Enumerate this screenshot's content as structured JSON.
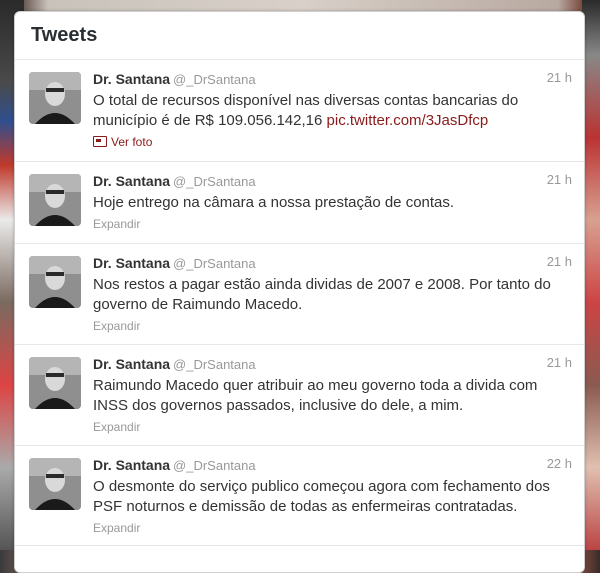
{
  "panel": {
    "title": "Tweets"
  },
  "tweets": [
    {
      "name": "Dr. Santana",
      "handle": "@_DrSantana",
      "time": "21 h",
      "text": "O total de recursos disponível nas diversas contas bancarias do município é de R$ 109.056.142,16",
      "link": "pic.twitter.com/3JasDfcp",
      "action": "Ver foto",
      "action_icon": "photo-icon"
    },
    {
      "name": "Dr. Santana",
      "handle": "@_DrSantana",
      "time": "21 h",
      "text": "Hoje entrego na câmara a nossa prestação de contas.",
      "action": "Expandir"
    },
    {
      "name": "Dr. Santana",
      "handle": "@_DrSantana",
      "time": "21 h",
      "text": "Nos restos a pagar estão ainda dividas de 2007 e 2008. Por tanto do governo de Raimundo Macedo.",
      "action": "Expandir"
    },
    {
      "name": "Dr. Santana",
      "handle": "@_DrSantana",
      "time": "21 h",
      "text": "Raimundo Macedo quer atribuir ao meu governo toda a divida com INSS dos governos passados, inclusive do dele, a mim.",
      "action": "Expandir"
    },
    {
      "name": "Dr. Santana",
      "handle": "@_DrSantana",
      "time": "22 h",
      "text": "O desmonte do serviço publico começou agora com fechamento dos PSF noturnos e demissão de todas as enfermeiras contratadas.",
      "action": "Expandir"
    }
  ]
}
